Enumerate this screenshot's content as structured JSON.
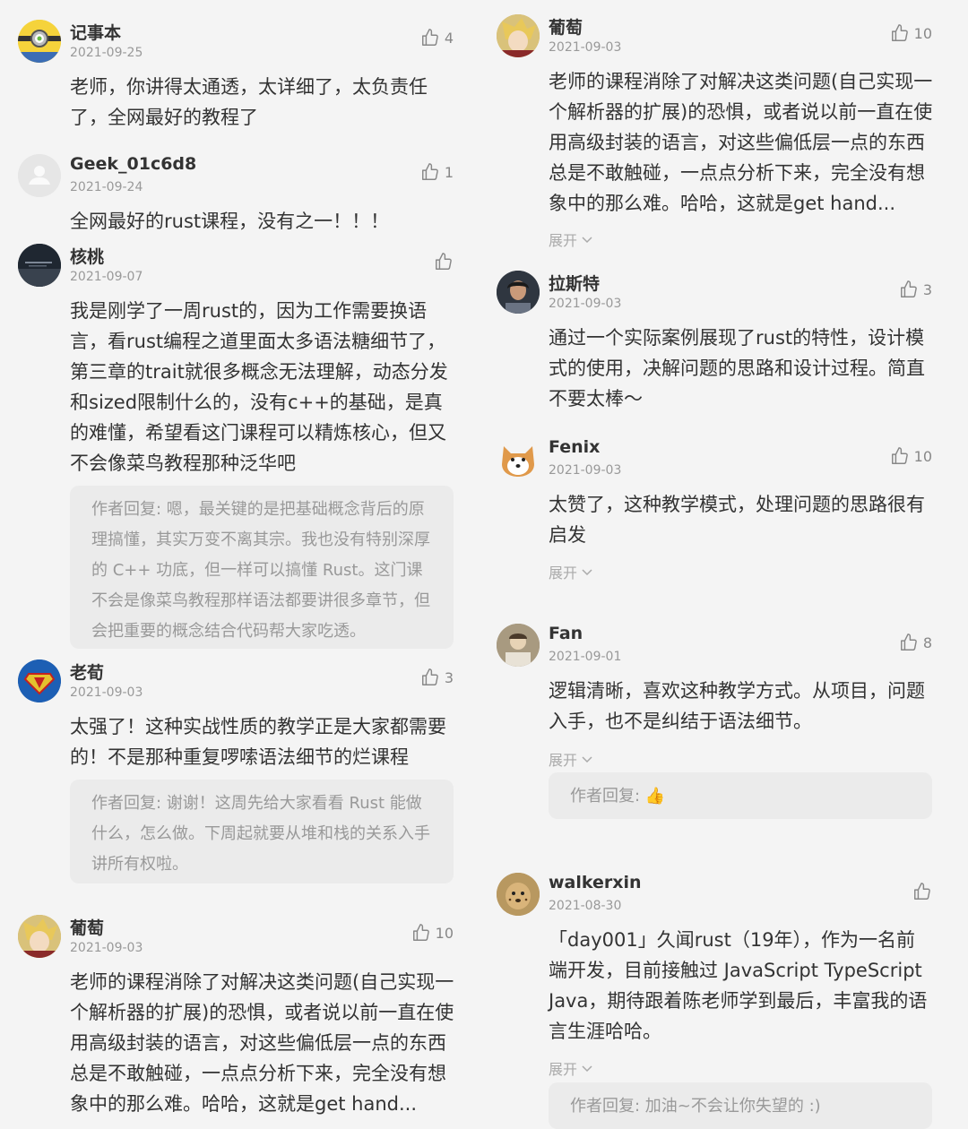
{
  "left_column": {
    "comments": [
      {
        "name": "记事本",
        "date": "2021-09-25",
        "likes": "4",
        "avatar_icon": "minion-avatar",
        "body": "老师，你讲得太通透，太详细了，太负责任了，全网最好的教程了"
      },
      {
        "name": "Geek_01c6d8",
        "date": "2021-09-24",
        "likes": "1",
        "avatar_icon": "default-user-avatar",
        "body": "全网最好的rust课程，没有之一！！！"
      },
      {
        "name": "核桃",
        "date": "2021-09-07",
        "likes": "",
        "avatar_icon": "night-city-avatar",
        "body": "我是刚学了一周rust的，因为工作需要换语言，看rust编程之道里面太多语法糖细节了，第三章的trait就很多概念无法理解，动态分发和sized限制什么的，没有c++的基础，是真的难懂，希望看这门课程可以精炼核心，但又不会像菜鸟教程那种泛华吧",
        "reply": "作者回复: 嗯，最关键的是把基础概念背后的原理搞懂，其实万变不离其宗。我也没有特别深厚的 C++ 功底，但一样可以搞懂 Rust。这门课不会是像菜鸟教程那样语法都要讲很多章节，但会把重要的概念结合代码帮大家吃透。"
      },
      {
        "name": "老荀",
        "date": "2021-09-03",
        "likes": "3",
        "avatar_icon": "superman-avatar",
        "body": "太强了！这种实战性质的教学正是大家都需要的！不是那种重复啰嗦语法细节的烂课程",
        "reply": "作者回复: 谢谢！这周先给大家看看 Rust 能做什么，怎么做。下周起就要从堆和栈的关系入手讲所有权啦。"
      },
      {
        "name": "葡萄",
        "date": "2021-09-03",
        "likes": "10",
        "avatar_icon": "anime-avatar",
        "body": "老师的课程消除了对解决这类问题(自己实现一个解析器的扩展)的恐惧，或者说以前一直在使用高级封装的语言，对这些偏低层一点的东西总是不敢触碰，一点点分析下来，完全没有想象中的那么难。哈哈，这就是get hand..."
      }
    ]
  },
  "right_column": {
    "comments": [
      {
        "name": "葡萄",
        "date": "2021-09-03",
        "likes": "10",
        "avatar_icon": "anime-avatar",
        "body": "老师的课程消除了对解决这类问题(自己实现一个解析器的扩展)的恐惧，或者说以前一直在使用高级封装的语言，对这些偏低层一点的东西总是不敢触碰，一点点分析下来，完全没有想象中的那么难。哈哈，这就是get hand...",
        "expand": "展开"
      },
      {
        "name": "拉斯特",
        "date": "2021-09-03",
        "likes": "3",
        "avatar_icon": "portrait-avatar",
        "body": "通过一个实际案例展现了rust的特性，设计模式的使用，决解问题的思路和设计过程。简直不要太棒～"
      },
      {
        "name": "Fenix",
        "date": "2021-09-03",
        "likes": "10",
        "avatar_icon": "shiba-avatar",
        "body": "太赞了，这种教学模式，处理问题的思路很有启发",
        "expand": "展开"
      },
      {
        "name": "Fan",
        "date": "2021-09-01",
        "likes": "8",
        "avatar_icon": "photo-avatar",
        "body": "逻辑清晰，喜欢这种教学方式。从项目，问题入手，也不是纠结于语法细节。",
        "expand": "展开",
        "reply": "作者回复: 👍"
      },
      {
        "name": "walkerxin",
        "date": "2021-08-30",
        "likes": "",
        "avatar_icon": "cheetah-avatar",
        "body": "「day001」久闻rust（19年），作为一名前端开发，目前接触过 JavaScript TypeScript Java，期待跟着陈老师学到最后，丰富我的语言生涯哈哈。",
        "expand": "展开",
        "reply": "作者回复: 加油~不会让你失望的 :)"
      }
    ]
  },
  "colors": {
    "background": "#f4f4f4",
    "reply_bg": "#ebebeb",
    "text": "#333333",
    "muted": "#999999"
  }
}
